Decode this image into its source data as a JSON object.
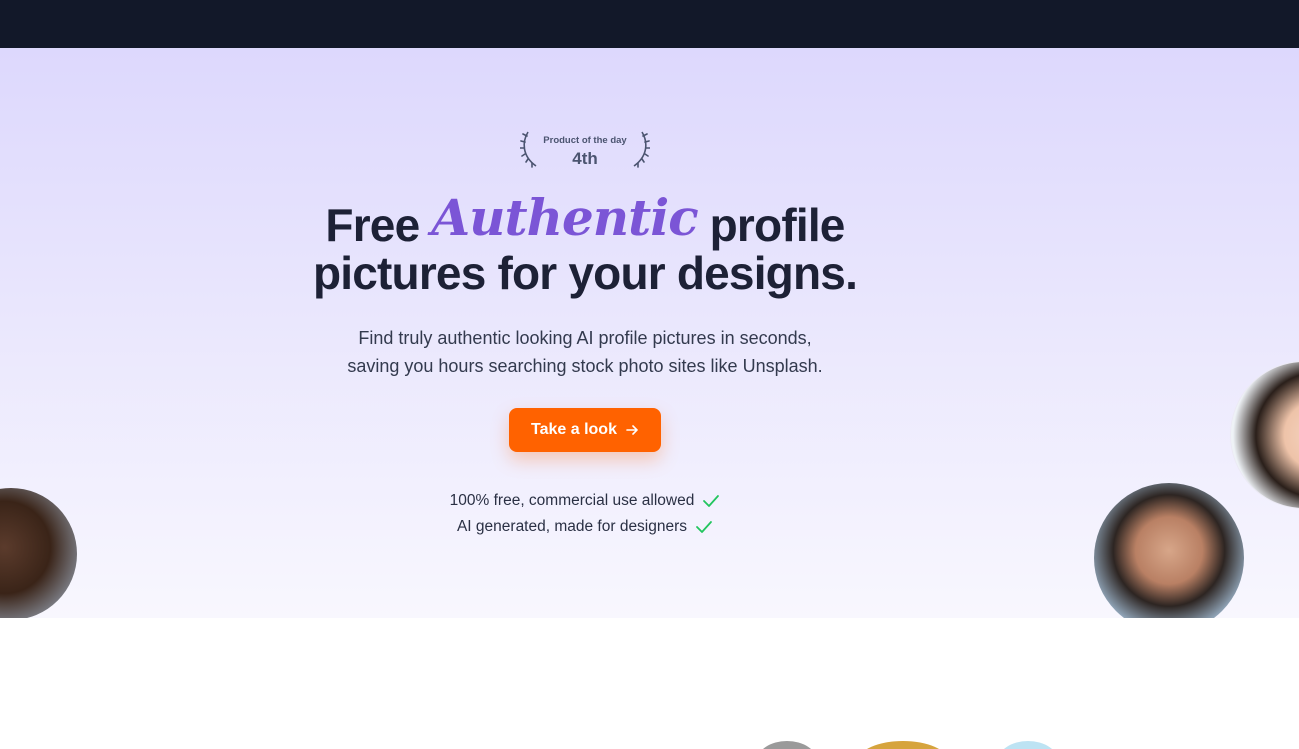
{
  "badge": {
    "label": "Product of the day",
    "rank": "4th"
  },
  "headline": {
    "before": "Free",
    "script": "Authentic",
    "after_line1": "profile",
    "line2": "pictures for your designs."
  },
  "subtitle": {
    "line1": "Find truly authentic looking AI profile pictures in seconds,",
    "line2": "saving you hours searching stock photo sites like Unsplash."
  },
  "cta": {
    "label": "Take a look",
    "icon": "arrow-right-icon"
  },
  "features": [
    {
      "text": "100% free, commercial use allowed",
      "icon": "check-icon"
    },
    {
      "text": "AI generated, made for designers",
      "icon": "check-icon"
    }
  ],
  "colors": {
    "topbar": "#121829",
    "accent_script": "#7b55d6",
    "cta": "#ff6200",
    "check": "#22c55e",
    "headline": "#1d2136"
  }
}
